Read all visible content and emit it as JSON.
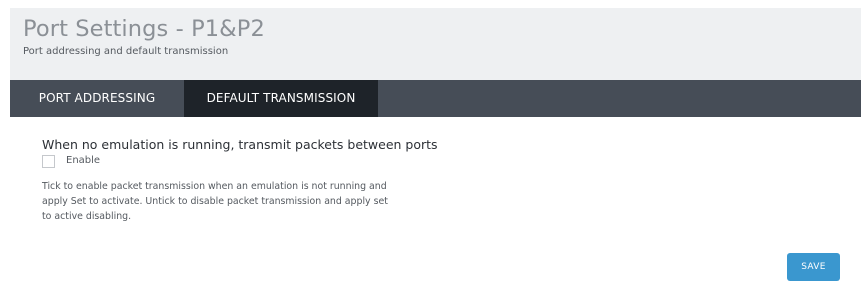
{
  "header": {
    "title": "Port Settings - P1&P2",
    "subtitle": "Port addressing and default transmission"
  },
  "tabs": [
    {
      "label": "PORT ADDRESSING",
      "active": false
    },
    {
      "label": "DEFAULT TRANSMISSION",
      "active": true
    }
  ],
  "transmission": {
    "heading": "When no emulation is running, transmit packets between ports",
    "enable_label": "Enable",
    "enable_checked": false,
    "help_lines": [
      "Tick to enable packet transmission when an emulation is not running and",
      "apply Set to activate. Untick to disable packet transmission and apply set",
      "to active disabling."
    ],
    "save_label": "SAVE"
  },
  "colors": {
    "header_bg": "#eef0f2",
    "tabbar_bg": "#464d57",
    "active_tab_bg": "#1e2329",
    "save_button_bg": "#3a97cf"
  }
}
